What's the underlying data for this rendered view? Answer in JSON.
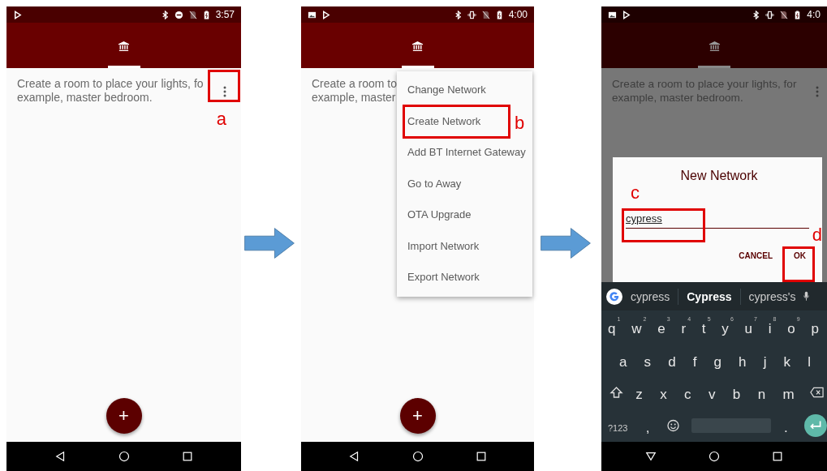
{
  "phones": [
    {
      "kind": "home",
      "status_bar": {
        "time": "3:57",
        "photo_notice": false,
        "vibrate": false
      },
      "description": [
        "Create a room to place your lights, fo",
        "example, master bedroom."
      ],
      "more_callout": "a",
      "fab_label": "+"
    },
    {
      "kind": "menu",
      "status_bar": {
        "time": "4:00",
        "photo_notice": true,
        "vibrate": true
      },
      "description": [
        "Create a room to",
        "example, master"
      ],
      "fab_label": "+",
      "menu": [
        {
          "label": "Change Network"
        },
        {
          "label": "Create Network",
          "callout": "b"
        },
        {
          "label": "Add BT Internet Gateway"
        },
        {
          "label": "Go to Away"
        },
        {
          "label": "OTA Upgrade"
        },
        {
          "label": "Import Network"
        },
        {
          "label": "Export Network"
        }
      ]
    },
    {
      "kind": "dialog",
      "status_bar": {
        "time": "4:0",
        "photo_notice": true,
        "vibrate": true
      },
      "description": [
        "Create a room to place your lights, for",
        "example, master bedroom."
      ],
      "dialog": {
        "title": "New Network",
        "value": "cypress",
        "field_callout": "c",
        "ok_callout": "d",
        "cancel": "CANCEL",
        "ok": "OK"
      },
      "keyboard": {
        "suggestions": [
          {
            "label": "cypress",
            "selected": false
          },
          {
            "label": "Cypress",
            "selected": true
          },
          {
            "label": "cypress's",
            "selected": false
          }
        ],
        "key_lines": [
          {
            "keys": [
              {
                "kind": "letter",
                "label": "q",
                "hint": "1"
              },
              {
                "kind": "letter",
                "label": "w",
                "hint": "2"
              },
              {
                "kind": "letter",
                "label": "e",
                "hint": "3"
              },
              {
                "kind": "letter",
                "label": "r",
                "hint": "4"
              },
              {
                "kind": "letter",
                "label": "t",
                "hint": "5"
              },
              {
                "kind": "letter",
                "label": "y",
                "hint": "6"
              },
              {
                "kind": "letter",
                "label": "u",
                "hint": "7"
              },
              {
                "kind": "letter",
                "label": "i",
                "hint": "8"
              },
              {
                "kind": "letter",
                "label": "o",
                "hint": "9"
              },
              {
                "kind": "letter",
                "label": "p"
              }
            ]
          },
          {
            "keys": [
              {
                "kind": "letter",
                "label": "a"
              },
              {
                "kind": "letter",
                "label": "s"
              },
              {
                "kind": "letter",
                "label": "d"
              },
              {
                "kind": "letter",
                "label": "f"
              },
              {
                "kind": "letter",
                "label": "g"
              },
              {
                "kind": "letter",
                "label": "h"
              },
              {
                "kind": "letter",
                "label": "j"
              },
              {
                "kind": "letter",
                "label": "k"
              },
              {
                "kind": "letter",
                "label": "l"
              }
            ]
          },
          {
            "keys": [
              {
                "kind": "shift"
              },
              {
                "kind": "letter",
                "label": "z"
              },
              {
                "kind": "letter",
                "label": "x"
              },
              {
                "kind": "letter",
                "label": "c"
              },
              {
                "kind": "letter",
                "label": "v"
              },
              {
                "kind": "letter",
                "label": "b"
              },
              {
                "kind": "letter",
                "label": "n"
              },
              {
                "kind": "letter",
                "label": "m"
              },
              {
                "kind": "backspace"
              }
            ]
          },
          {
            "keys": [
              {
                "kind": "symbols",
                "label": "?123"
              },
              {
                "kind": "letter",
                "label": ","
              },
              {
                "kind": "emoji"
              },
              {
                "kind": "space"
              },
              {
                "kind": "letter",
                "label": "."
              },
              {
                "kind": "enter"
              }
            ]
          }
        ]
      }
    }
  ]
}
